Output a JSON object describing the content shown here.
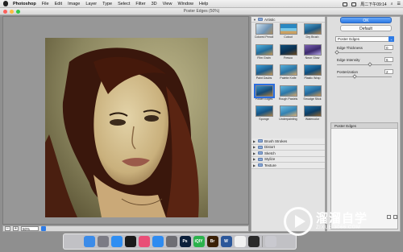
{
  "menubar": {
    "app_name": "Photoshop",
    "items": [
      "File",
      "Edit",
      "Image",
      "Layer",
      "Type",
      "Select",
      "Filter",
      "3D",
      "View",
      "Window",
      "Help"
    ],
    "right_text": "周二下午09:14"
  },
  "window": {
    "title": "Poster Edges (50%)"
  },
  "preview": {
    "zoom": "50%",
    "zoom_minus": "−",
    "zoom_plus": "+"
  },
  "gallery": {
    "open_category": "Artistic",
    "filters": [
      {
        "name": "Colored Pencil",
        "icon": "colored-pencil-thumb"
      },
      {
        "name": "Cutout",
        "icon": "cutout-thumb"
      },
      {
        "name": "Dry Brush",
        "icon": "dry-brush-thumb"
      },
      {
        "name": "Film Grain",
        "icon": "film-grain-thumb"
      },
      {
        "name": "Fresco",
        "icon": "fresco-thumb"
      },
      {
        "name": "Neon Glow",
        "icon": "neon-glow-thumb"
      },
      {
        "name": "Paint Daubs",
        "icon": "paint-daubs-thumb"
      },
      {
        "name": "Palette Knife",
        "icon": "palette-knife-thumb"
      },
      {
        "name": "Plastic Wrap",
        "icon": "plastic-wrap-thumb"
      },
      {
        "name": "Poster Edges",
        "icon": "poster-edges-thumb"
      },
      {
        "name": "Rough Pastels",
        "icon": "rough-pastels-thumb"
      },
      {
        "name": "Smudge Stick",
        "icon": "smudge-stick-thumb"
      },
      {
        "name": "Sponge",
        "icon": "sponge-thumb"
      },
      {
        "name": "Underpainting",
        "icon": "underpainting-thumb"
      },
      {
        "name": "Watercolor",
        "icon": "watercolor-thumb"
      }
    ],
    "selected_filter": "Poster Edges",
    "collapsed_categories": [
      "Brush Strokes",
      "Distort",
      "Sketch",
      "Stylize",
      "Texture"
    ]
  },
  "settings": {
    "ok_label": "OK",
    "default_label": "Default",
    "filter_select": "Poster Edges",
    "params": [
      {
        "label": "Edge Thickness",
        "value": "0",
        "fraction": 0.0
      },
      {
        "label": "Edge Intensity",
        "value": "6",
        "fraction": 0.6
      },
      {
        "label": "Posterization",
        "value": "2",
        "fraction": 0.33
      }
    ],
    "layer_name": "Poster Edges"
  },
  "dock": {
    "apps": [
      {
        "name": "finder-icon",
        "label": "",
        "color": "#3b8be8"
      },
      {
        "name": "launchpad-icon",
        "label": "",
        "color": "#7b7b85"
      },
      {
        "name": "safari-icon",
        "label": "",
        "color": "#2f8ef2"
      },
      {
        "name": "qq-icon",
        "label": "",
        "color": "#1a1a1a"
      },
      {
        "name": "photos-icon",
        "label": "",
        "color": "#e94e77"
      },
      {
        "name": "app-store-icon",
        "label": "",
        "color": "#2e8bf0"
      },
      {
        "name": "system-preferences-icon",
        "label": "",
        "color": "#6e6e74"
      },
      {
        "name": "photoshop-icon",
        "label": "Ps",
        "color": "#0b1f3a"
      },
      {
        "name": "iqiyi-icon",
        "label": "iQIY",
        "color": "#2bb24c"
      },
      {
        "name": "bridge-icon",
        "label": "Br",
        "color": "#3a2006"
      },
      {
        "name": "word-icon",
        "label": "W",
        "color": "#2b579a"
      },
      {
        "name": "document-icon",
        "label": "",
        "color": "#f1f1f1"
      },
      {
        "name": "camera-icon",
        "label": "",
        "color": "#2a2a2a"
      },
      {
        "name": "trash-icon",
        "label": "",
        "color": "#c9c9cf"
      }
    ]
  },
  "watermark": {
    "title": "溜溜自学",
    "url": "ZIXUE.3066.COM"
  }
}
